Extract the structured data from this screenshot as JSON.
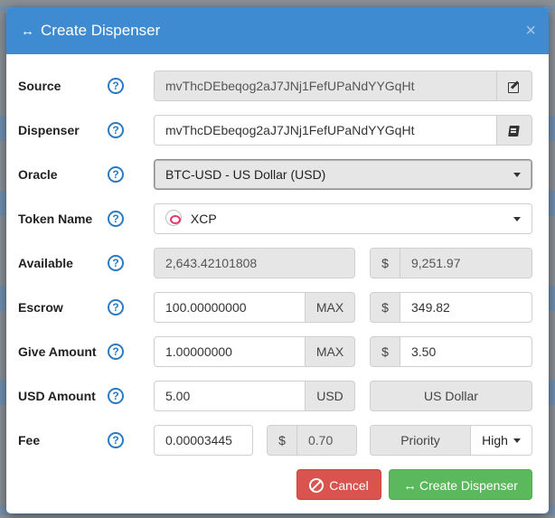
{
  "modal": {
    "title": "Create Dispenser",
    "close_label": "×"
  },
  "fields": {
    "source": {
      "label": "Source",
      "value": "mvThcDEbeqog2aJ7JNj1FefUPaNdYYGqHt",
      "icon": "edit-icon"
    },
    "dispenser": {
      "label": "Dispenser",
      "value": "mvThcDEbeqog2aJ7JNj1FefUPaNdYYGqHt",
      "icon": "address-book-icon"
    },
    "oracle": {
      "label": "Oracle",
      "selected": "BTC-USD - US Dollar (USD)"
    },
    "token_name": {
      "label": "Token Name",
      "selected": "XCP",
      "icon": "xcp-token-icon"
    },
    "available": {
      "label": "Available",
      "value": "2,643.42101808",
      "currency_symbol": "$",
      "usd_value": "9,251.97"
    },
    "escrow": {
      "label": "Escrow",
      "value": "100.00000000",
      "max_label": "MAX",
      "currency_symbol": "$",
      "usd_value": "349.82"
    },
    "give_amount": {
      "label": "Give Amount",
      "value": "1.00000000",
      "max_label": "MAX",
      "currency_symbol": "$",
      "usd_value": "3.50"
    },
    "usd_amount": {
      "label": "USD Amount",
      "value": "5.00",
      "unit": "USD",
      "currency_name": "US Dollar"
    },
    "fee": {
      "label": "Fee",
      "value": "0.00003445",
      "currency_symbol": "$",
      "usd_value": "0.70",
      "priority_label": "Priority",
      "priority_selected": "High"
    }
  },
  "help_glyph": "?",
  "buttons": {
    "cancel": "Cancel",
    "create": "Create Dispenser"
  },
  "colors": {
    "header": "#3f8bd1",
    "help": "#2a7ac4",
    "cancel": "#d9534f",
    "create": "#5cb85c"
  }
}
